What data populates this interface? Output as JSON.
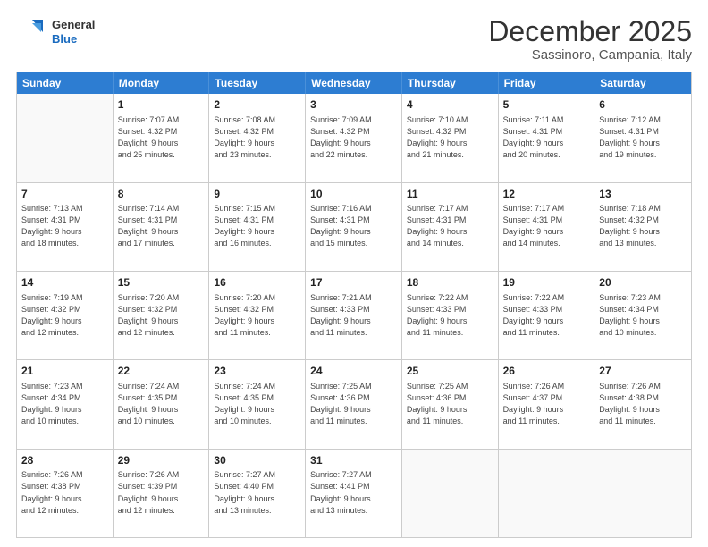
{
  "logo": {
    "line1": "General",
    "line2": "Blue"
  },
  "title": "December 2025",
  "location": "Sassinoro, Campania, Italy",
  "weekdays": [
    "Sunday",
    "Monday",
    "Tuesday",
    "Wednesday",
    "Thursday",
    "Friday",
    "Saturday"
  ],
  "rows": [
    [
      {
        "day": "",
        "info": ""
      },
      {
        "day": "1",
        "info": "Sunrise: 7:07 AM\nSunset: 4:32 PM\nDaylight: 9 hours\nand 25 minutes."
      },
      {
        "day": "2",
        "info": "Sunrise: 7:08 AM\nSunset: 4:32 PM\nDaylight: 9 hours\nand 23 minutes."
      },
      {
        "day": "3",
        "info": "Sunrise: 7:09 AM\nSunset: 4:32 PM\nDaylight: 9 hours\nand 22 minutes."
      },
      {
        "day": "4",
        "info": "Sunrise: 7:10 AM\nSunset: 4:32 PM\nDaylight: 9 hours\nand 21 minutes."
      },
      {
        "day": "5",
        "info": "Sunrise: 7:11 AM\nSunset: 4:31 PM\nDaylight: 9 hours\nand 20 minutes."
      },
      {
        "day": "6",
        "info": "Sunrise: 7:12 AM\nSunset: 4:31 PM\nDaylight: 9 hours\nand 19 minutes."
      }
    ],
    [
      {
        "day": "7",
        "info": "Sunrise: 7:13 AM\nSunset: 4:31 PM\nDaylight: 9 hours\nand 18 minutes."
      },
      {
        "day": "8",
        "info": "Sunrise: 7:14 AM\nSunset: 4:31 PM\nDaylight: 9 hours\nand 17 minutes."
      },
      {
        "day": "9",
        "info": "Sunrise: 7:15 AM\nSunset: 4:31 PM\nDaylight: 9 hours\nand 16 minutes."
      },
      {
        "day": "10",
        "info": "Sunrise: 7:16 AM\nSunset: 4:31 PM\nDaylight: 9 hours\nand 15 minutes."
      },
      {
        "day": "11",
        "info": "Sunrise: 7:17 AM\nSunset: 4:31 PM\nDaylight: 9 hours\nand 14 minutes."
      },
      {
        "day": "12",
        "info": "Sunrise: 7:17 AM\nSunset: 4:31 PM\nDaylight: 9 hours\nand 14 minutes."
      },
      {
        "day": "13",
        "info": "Sunrise: 7:18 AM\nSunset: 4:32 PM\nDaylight: 9 hours\nand 13 minutes."
      }
    ],
    [
      {
        "day": "14",
        "info": "Sunrise: 7:19 AM\nSunset: 4:32 PM\nDaylight: 9 hours\nand 12 minutes."
      },
      {
        "day": "15",
        "info": "Sunrise: 7:20 AM\nSunset: 4:32 PM\nDaylight: 9 hours\nand 12 minutes."
      },
      {
        "day": "16",
        "info": "Sunrise: 7:20 AM\nSunset: 4:32 PM\nDaylight: 9 hours\nand 11 minutes."
      },
      {
        "day": "17",
        "info": "Sunrise: 7:21 AM\nSunset: 4:33 PM\nDaylight: 9 hours\nand 11 minutes."
      },
      {
        "day": "18",
        "info": "Sunrise: 7:22 AM\nSunset: 4:33 PM\nDaylight: 9 hours\nand 11 minutes."
      },
      {
        "day": "19",
        "info": "Sunrise: 7:22 AM\nSunset: 4:33 PM\nDaylight: 9 hours\nand 11 minutes."
      },
      {
        "day": "20",
        "info": "Sunrise: 7:23 AM\nSunset: 4:34 PM\nDaylight: 9 hours\nand 10 minutes."
      }
    ],
    [
      {
        "day": "21",
        "info": "Sunrise: 7:23 AM\nSunset: 4:34 PM\nDaylight: 9 hours\nand 10 minutes."
      },
      {
        "day": "22",
        "info": "Sunrise: 7:24 AM\nSunset: 4:35 PM\nDaylight: 9 hours\nand 10 minutes."
      },
      {
        "day": "23",
        "info": "Sunrise: 7:24 AM\nSunset: 4:35 PM\nDaylight: 9 hours\nand 10 minutes."
      },
      {
        "day": "24",
        "info": "Sunrise: 7:25 AM\nSunset: 4:36 PM\nDaylight: 9 hours\nand 11 minutes."
      },
      {
        "day": "25",
        "info": "Sunrise: 7:25 AM\nSunset: 4:36 PM\nDaylight: 9 hours\nand 11 minutes."
      },
      {
        "day": "26",
        "info": "Sunrise: 7:26 AM\nSunset: 4:37 PM\nDaylight: 9 hours\nand 11 minutes."
      },
      {
        "day": "27",
        "info": "Sunrise: 7:26 AM\nSunset: 4:38 PM\nDaylight: 9 hours\nand 11 minutes."
      }
    ],
    [
      {
        "day": "28",
        "info": "Sunrise: 7:26 AM\nSunset: 4:38 PM\nDaylight: 9 hours\nand 12 minutes."
      },
      {
        "day": "29",
        "info": "Sunrise: 7:26 AM\nSunset: 4:39 PM\nDaylight: 9 hours\nand 12 minutes."
      },
      {
        "day": "30",
        "info": "Sunrise: 7:27 AM\nSunset: 4:40 PM\nDaylight: 9 hours\nand 13 minutes."
      },
      {
        "day": "31",
        "info": "Sunrise: 7:27 AM\nSunset: 4:41 PM\nDaylight: 9 hours\nand 13 minutes."
      },
      {
        "day": "",
        "info": ""
      },
      {
        "day": "",
        "info": ""
      },
      {
        "day": "",
        "info": ""
      }
    ]
  ]
}
